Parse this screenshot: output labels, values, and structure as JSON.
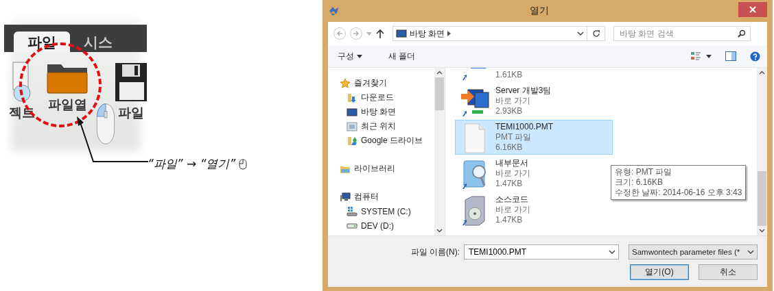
{
  "figure": {
    "tabs": [
      {
        "label": "파일",
        "selected": true
      },
      {
        "label": "시스",
        "selected": false
      }
    ],
    "tools": [
      {
        "label": "젝트",
        "kind": "partial"
      },
      {
        "label": "파일열",
        "kind": "folder"
      },
      {
        "label": "파일",
        "kind": "save"
      }
    ],
    "caption": "“파일” → “열기”"
  },
  "window": {
    "title": "열기"
  },
  "address_bar": {
    "path": "바탕 화면"
  },
  "search": {
    "placeholder": "바탕 화면 검색"
  },
  "commands": [
    {
      "label": "구성",
      "kind": "menu"
    },
    {
      "label": "새 폴더",
      "kind": "button"
    }
  ],
  "sidebar": {
    "items": [
      {
        "label": "즐겨찾기",
        "kind": "star",
        "children": [
          {
            "label": "다운로드",
            "kind": "downloads"
          },
          {
            "label": "바탕 화면",
            "kind": "desktop"
          },
          {
            "label": "최근 위치",
            "kind": "recent"
          },
          {
            "label": "Google 드라이브",
            "kind": "drive"
          }
        ]
      },
      {
        "label": "라이브러리",
        "kind": "library"
      },
      {
        "label": "컴퓨터",
        "kind": "computer",
        "children": [
          {
            "label": "SYSTEM (C:)",
            "kind": "system-drive"
          },
          {
            "label": "DEV (D:)",
            "kind": "drive-disk"
          }
        ]
      }
    ]
  },
  "files": [
    {
      "size": "1.61KB",
      "kind": "cloud",
      "selected": false
    },
    {
      "name": "Server 개발3팀",
      "type": "바로 가기",
      "size": "2.93KB",
      "kind": "network",
      "selected": false
    },
    {
      "name": "TEMI1000.PMT",
      "type": "PMT 파일",
      "size": "6.16KB",
      "kind": "document",
      "selected": true
    },
    {
      "name": "내부문서",
      "type": "바로 가기",
      "size": "1.47KB",
      "kind": "search-folder",
      "selected": false
    },
    {
      "name": "소스코드",
      "type": "바로 가기",
      "size": "1.47KB",
      "kind": "installer",
      "selected": false
    }
  ],
  "tooltip": [
    "유형: PMT 파일",
    "크기: 6.16KB",
    "수정한 날짜: 2014-06-16 오후 3:43"
  ],
  "file_name": {
    "label": "파일 이름(N):",
    "value": "TEMI1000.PMT"
  },
  "file_type": {
    "value": "Samwontech parameter files (*"
  },
  "buttons": [
    {
      "label": "열기(O)",
      "kind": "default"
    },
    {
      "label": "취소",
      "kind": "normal"
    }
  ]
}
